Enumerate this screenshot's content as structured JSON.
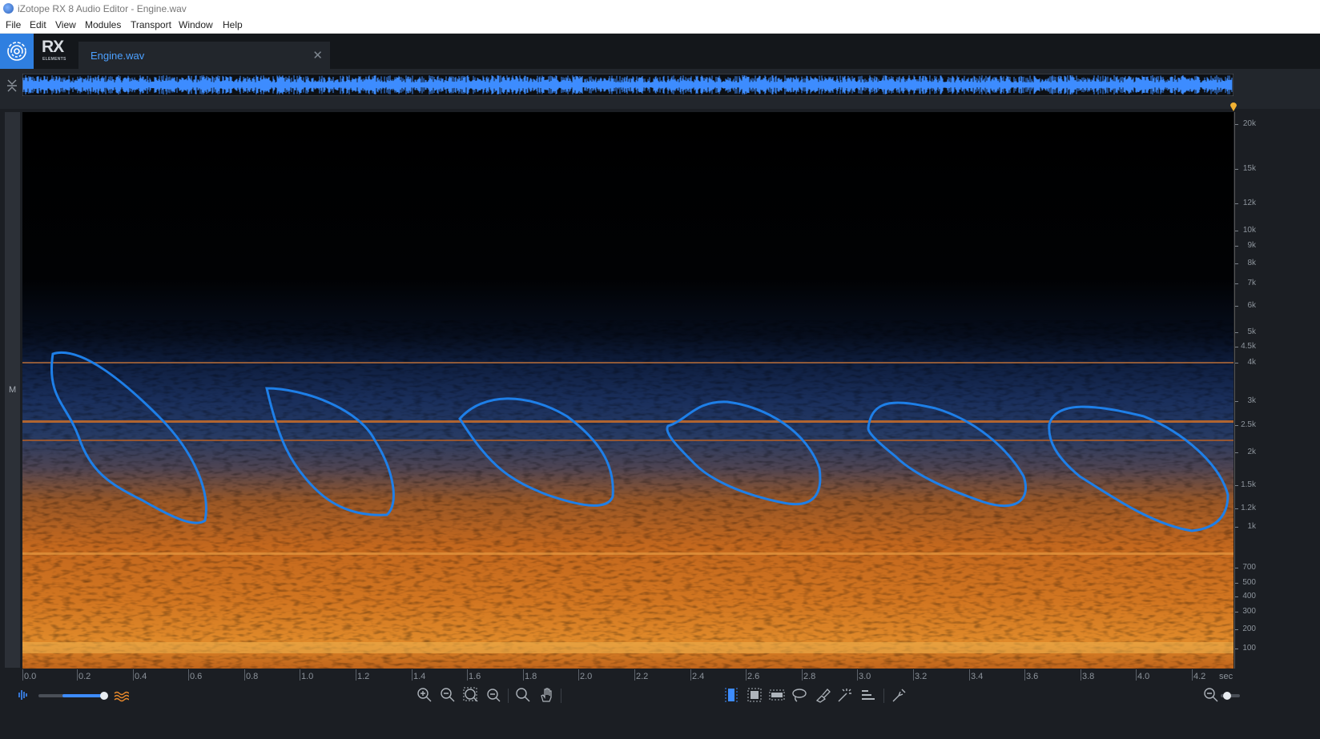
{
  "window": {
    "title": "iZotope RX 8 Audio Editor - Engine.wav"
  },
  "menu": [
    "File",
    "Edit",
    "View",
    "Modules",
    "Transport",
    "Window",
    "Help"
  ],
  "brand": {
    "mark": "RX",
    "sub": "ELEMENTS"
  },
  "tab": {
    "name": "Engine.wav",
    "close": "✕"
  },
  "channel_label": "M",
  "freq_axis": {
    "labels": [
      "20k",
      "15k",
      "12k",
      "10k",
      "9k",
      "8k",
      "7k",
      "6k",
      "5k",
      "4.5k",
      "4k",
      "3k",
      "2.5k",
      "2k",
      "1.5k",
      "1.2k",
      "1k",
      "700",
      "500",
      "400",
      "300",
      "200",
      "100"
    ]
  },
  "time_axis": {
    "labels": [
      "0.0",
      "0.2",
      "0.4",
      "0.6",
      "0.8",
      "1.0",
      "1.2",
      "1.4",
      "1.6",
      "1.8",
      "2.0",
      "2.2",
      "2.4",
      "2.6",
      "2.8",
      "3.0",
      "3.2",
      "3.4",
      "3.6",
      "3.8",
      "4.0",
      "4.2"
    ],
    "unit": "sec"
  },
  "colors": {
    "accent": "#2f7fe0",
    "waveform": "#3d8cff",
    "annotation": "#1e7fe8",
    "playhead": "#f2b233"
  }
}
